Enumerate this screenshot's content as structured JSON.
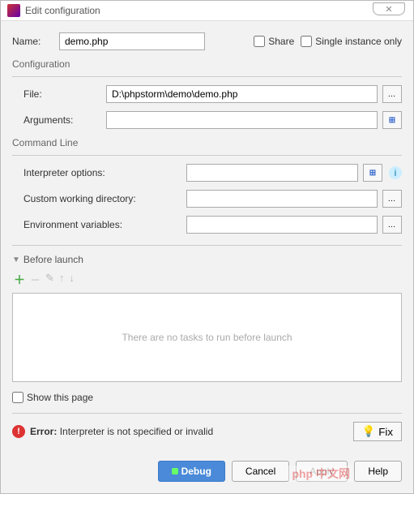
{
  "window": {
    "title": "Edit configuration"
  },
  "header": {
    "name_label": "Name:",
    "name_value": "demo.php",
    "share_label": "Share",
    "single_instance_label": "Single instance only"
  },
  "config": {
    "section": "Configuration",
    "file_label": "File:",
    "file_value": "D:\\phpstorm\\demo\\demo.php",
    "args_label": "Arguments:",
    "args_value": ""
  },
  "cmdline": {
    "section": "Command Line",
    "interp_label": "Interpreter options:",
    "interp_value": "",
    "cwd_label": "Custom working directory:",
    "cwd_value": "",
    "env_label": "Environment variables:",
    "env_value": ""
  },
  "launch": {
    "section": "Before launch",
    "empty_text": "There are no tasks to run before launch",
    "show_page_label": "Show this page"
  },
  "error": {
    "label": "Error:",
    "message": "Interpreter is not specified or invalid",
    "fix": "Fix"
  },
  "buttons": {
    "debug": "Debug",
    "cancel": "Cancel",
    "apply": "Apply",
    "help": "Help"
  },
  "watermark": "php 中文网"
}
